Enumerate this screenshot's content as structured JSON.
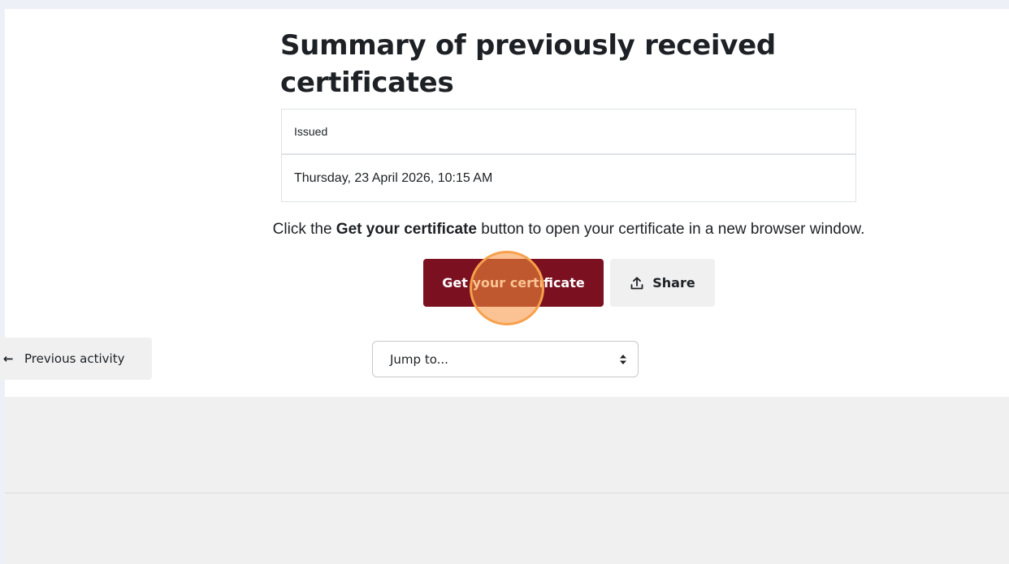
{
  "page": {
    "title": "Summary of previously received certificates"
  },
  "certificates_table": {
    "header": "Issued",
    "rows": [
      {
        "issued": "Thursday, 23 April 2026, 10:15 AM"
      }
    ]
  },
  "instruction": {
    "prefix": "Click the ",
    "emphasis": "Get your certificate",
    "suffix": " button to open your certificate in a new browser window."
  },
  "actions": {
    "primary_label": "Get your certificate",
    "share_label": "Share",
    "share_icon": "upload-icon"
  },
  "navigation": {
    "prev_arrow": "←",
    "prev_label": "Previous activity",
    "jump_placeholder": "Jump to...",
    "jump_icon": "sort-arrows-icon"
  },
  "colors": {
    "primary": "#7b1020",
    "secondary_bg": "#f0f0f0",
    "click_indicator": "#f7a04b"
  }
}
